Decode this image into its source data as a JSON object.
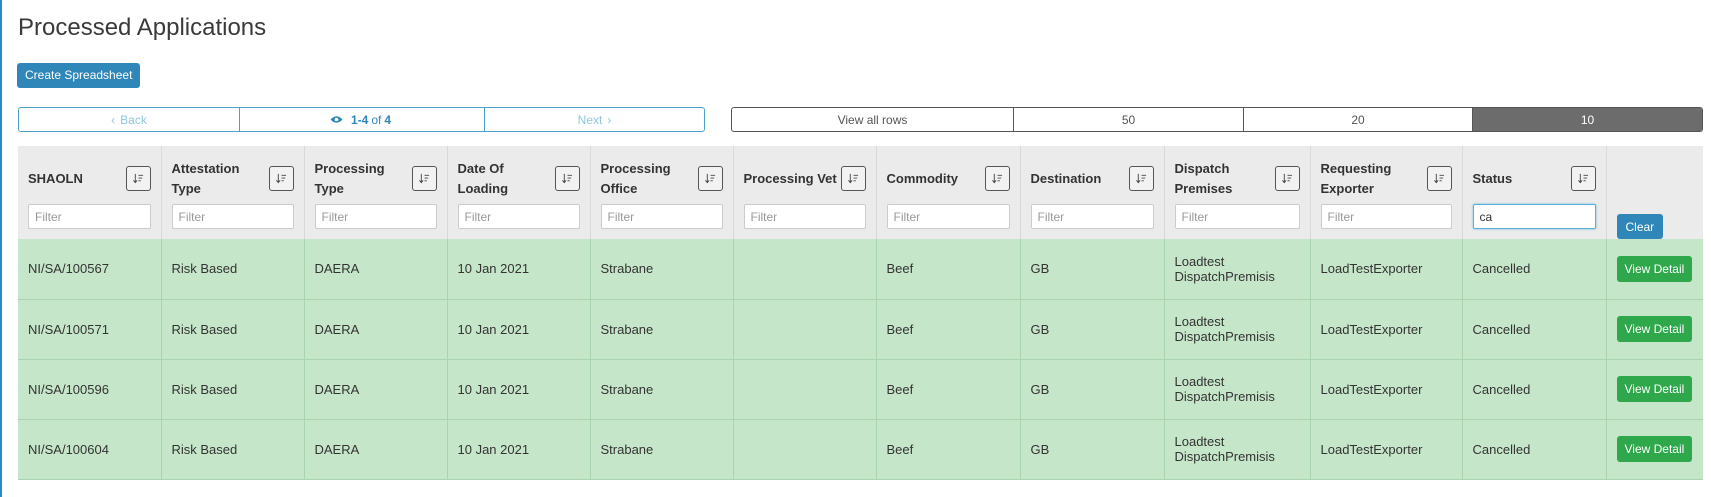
{
  "page": {
    "title": "Processed Applications",
    "create_label": "Create Spreadsheet"
  },
  "pager": {
    "back_label": "Back",
    "range": "1-4",
    "of_label": "of",
    "total": "4",
    "next_label": "Next"
  },
  "row_options": [
    "View all rows",
    "50",
    "20",
    "10"
  ],
  "selected_rows": "10",
  "columns": [
    {
      "label": "SHAOLN",
      "filter_value": "",
      "filter_placeholder": "Filter"
    },
    {
      "label": "Attestation Type",
      "filter_value": "",
      "filter_placeholder": "Filter"
    },
    {
      "label": "Processing Type",
      "filter_value": "",
      "filter_placeholder": "Filter"
    },
    {
      "label": "Date Of Loading",
      "filter_value": "",
      "filter_placeholder": "Filter"
    },
    {
      "label": "Processing Office",
      "filter_value": "",
      "filter_placeholder": "Filter"
    },
    {
      "label": "Processing Vet",
      "filter_value": "",
      "filter_placeholder": "Filter"
    },
    {
      "label": "Commodity",
      "filter_value": "",
      "filter_placeholder": "Filter"
    },
    {
      "label": "Destination",
      "filter_value": "",
      "filter_placeholder": "Filter"
    },
    {
      "label": "Dispatch Premises",
      "filter_value": "",
      "filter_placeholder": "Filter"
    },
    {
      "label": "Requesting Exporter",
      "filter_value": "",
      "filter_placeholder": "Filter"
    },
    {
      "label": "Status",
      "filter_value": "ca",
      "filter_placeholder": "Filter"
    }
  ],
  "clear_label": "Clear",
  "view_label": "View Detail",
  "rows": [
    [
      "NI/SA/100567",
      "Risk Based",
      "DAERA",
      "10 Jan 2021",
      "Strabane",
      "",
      "Beef",
      "GB",
      "Loadtest DispatchPremisis",
      "LoadTestExporter",
      "Cancelled"
    ],
    [
      "NI/SA/100571",
      "Risk Based",
      "DAERA",
      "10 Jan 2021",
      "Strabane",
      "",
      "Beef",
      "GB",
      "Loadtest DispatchPremisis",
      "LoadTestExporter",
      "Cancelled"
    ],
    [
      "NI/SA/100596",
      "Risk Based",
      "DAERA",
      "10 Jan 2021",
      "Strabane",
      "",
      "Beef",
      "GB",
      "Loadtest DispatchPremisis",
      "LoadTestExporter",
      "Cancelled"
    ],
    [
      "NI/SA/100604",
      "Risk Based",
      "DAERA",
      "10 Jan 2021",
      "Strabane",
      "",
      "Beef",
      "GB",
      "Loadtest DispatchPremisis",
      "LoadTestExporter",
      "Cancelled"
    ]
  ],
  "icons": {
    "back": "chevron-left-icon",
    "next": "chevron-right-icon",
    "count": "eye-icon",
    "sort": "sort-icon"
  }
}
